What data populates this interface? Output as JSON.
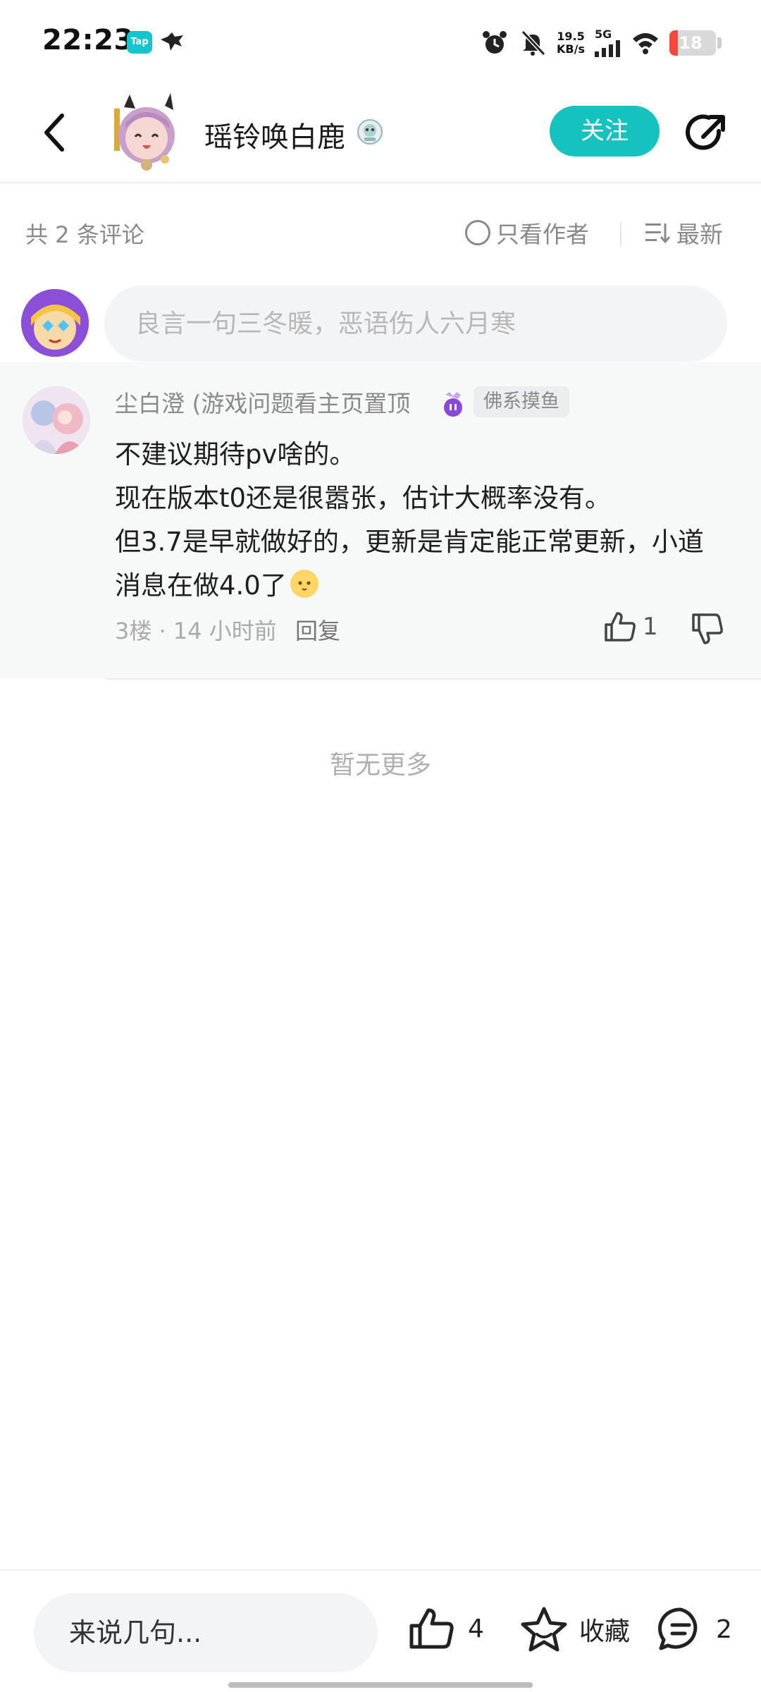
{
  "status_bar": {
    "time": "22:23",
    "tap_label": "Tap",
    "net_speed_value": "19.5",
    "net_speed_unit": "KB/s",
    "network": "5G",
    "battery": "18",
    "battery_level": 0.18,
    "battery_color": "#f2493f"
  },
  "header": {
    "author_name": "瑶铃唤白鹿",
    "follow_label": "关注",
    "accent_color": "#16c2bd"
  },
  "comments_bar": {
    "count_text": "共 2 条评论",
    "author_only_label": "只看作者",
    "sort_label": "最新"
  },
  "composer": {
    "placeholder": "良言一句三冬暖，恶语伤人六月寒"
  },
  "comment": {
    "author": "尘白澄 (游戏问题看主页置顶",
    "tag": "佛系摸鱼",
    "lines": [
      "不建议期待pv啥的。",
      "现在版本t0还是很嚣张，估计大概率没有。",
      "但3.7是早就做好的，更新是肯定能正常更新，小道消息在做4.0了"
    ],
    "floor": "3楼",
    "separator": "·",
    "time_ago": "14 小时前",
    "reply_label": "回复",
    "like_count": "1"
  },
  "no_more_text": "暂无更多",
  "bottom_bar": {
    "input_text": "来说几句...",
    "like_count": "4",
    "favorite_label": "收藏",
    "comment_count": "2"
  },
  "icons": [
    "back-icon",
    "share-icon",
    "verified-badge-icon",
    "radio-icon",
    "sort-icon",
    "medal-icon",
    "thumbs-up-icon",
    "thumbs-down-icon",
    "star-icon",
    "comment-icon",
    "alarm-icon",
    "mute-icon",
    "signal-icon",
    "wifi-icon",
    "battery-icon",
    "bird-icon",
    "emoji-icon"
  ]
}
